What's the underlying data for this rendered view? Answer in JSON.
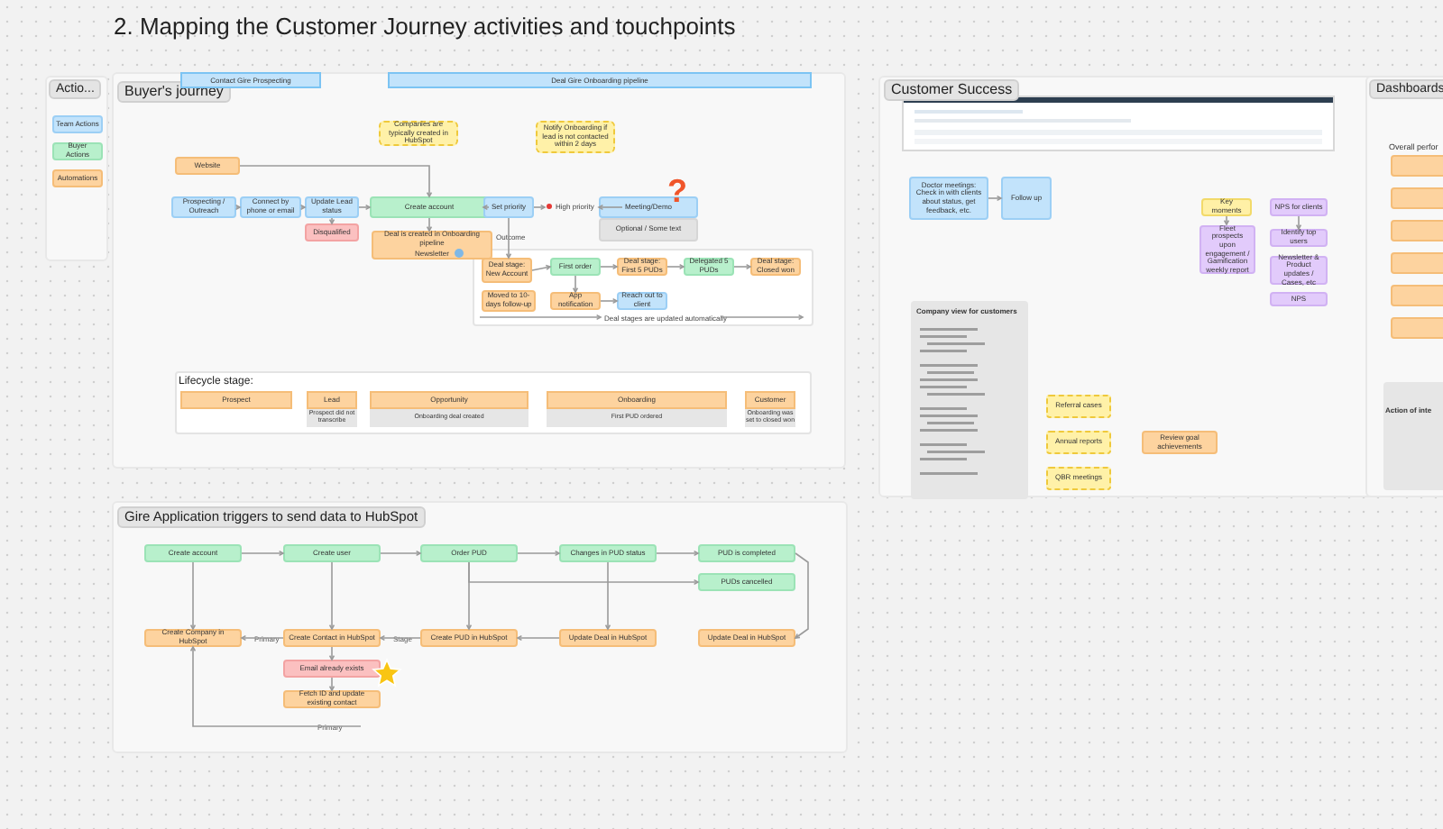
{
  "page_title": "2. Mapping the Customer Journey activities and touchpoints",
  "legend": {
    "title": "Actio...",
    "items": [
      {
        "label": "Team Actions",
        "kind": "blue"
      },
      {
        "label": "Buyer Actions",
        "kind": "green"
      },
      {
        "label": "Automations",
        "kind": "orange"
      }
    ]
  },
  "buyer_journey": {
    "title": "Buyer's journey",
    "banners": [
      "Contact Gire Prospecting",
      "Deal Gire Onboarding pipeline"
    ],
    "notes": [
      "Companies are typically created in HubSpot",
      "Notify Onboarding if lead is not contacted within 2 days"
    ],
    "nodes": [
      {
        "text": "Website",
        "kind": "orange"
      },
      {
        "text": "Prospecting / Outreach",
        "kind": "blue"
      },
      {
        "text": "Connect by phone or email",
        "kind": "blue"
      },
      {
        "text": "Update Lead status",
        "kind": "blue"
      },
      {
        "text": "Disqualified",
        "kind": "red"
      },
      {
        "text": "Create account",
        "kind": "green"
      },
      {
        "text": "Deal is created in Onboarding pipeline",
        "kind": "orange",
        "sub": "Newsletter"
      },
      {
        "text": "Set priority",
        "kind": "blue"
      },
      {
        "text": "Meeting/Demo",
        "kind": "blue"
      },
      {
        "text": "Optional / Some text",
        "kind": "gray"
      },
      {
        "text": "Deal stage: New Account",
        "kind": "orange"
      },
      {
        "text": "First order",
        "kind": "green"
      },
      {
        "text": "Deal stage: First 5 PUDs",
        "kind": "orange"
      },
      {
        "text": "Delegated 5 PUDs",
        "kind": "green"
      },
      {
        "text": "Deal stage: Closed won",
        "kind": "orange"
      },
      {
        "text": "Moved to 10-days follow-up",
        "kind": "orange"
      },
      {
        "text": "App notification",
        "kind": "orange"
      },
      {
        "text": "Reach out to client",
        "kind": "blue"
      }
    ],
    "question_mark": "?",
    "priority_label": "High priority",
    "outcome_label": "Outcome",
    "auto_label": "Deal stages are updated automatically",
    "lifecycle": {
      "title": "Lifecycle stage:",
      "stages": [
        {
          "name": "Prospect"
        },
        {
          "name": "Lead",
          "note": "Prospect did not transcribe"
        },
        {
          "name": "Opportunity",
          "note": "Onboarding deal created"
        },
        {
          "name": "Onboarding",
          "note": "First PUD ordered"
        },
        {
          "name": "Customer",
          "note": "Onboarding was set to closed won"
        }
      ]
    }
  },
  "triggers": {
    "title": "Gire Application triggers to send data to HubSpot",
    "nodes": [
      {
        "text": "Create account",
        "kind": "green"
      },
      {
        "text": "Create user",
        "kind": "green"
      },
      {
        "text": "Order PUD",
        "kind": "green"
      },
      {
        "text": "Changes in PUD status",
        "kind": "green"
      },
      {
        "text": "PUD is completed",
        "kind": "green"
      },
      {
        "text": "PUDs cancelled",
        "kind": "green"
      },
      {
        "text": "Create Company in HubSpot",
        "kind": "orange"
      },
      {
        "text": "Create Contact in HubSpot",
        "kind": "orange"
      },
      {
        "text": "Create PUD in HubSpot",
        "kind": "orange"
      },
      {
        "text": "Update Deal in HubSpot",
        "kind": "orange"
      },
      {
        "text": "Update Deal in HubSpot",
        "kind": "orange"
      },
      {
        "text": "Email already exists",
        "kind": "red"
      },
      {
        "text": "Fetch ID and update existing contact",
        "kind": "orange"
      }
    ],
    "edge_labels": [
      "Primary",
      "Stage",
      "Primary"
    ]
  },
  "customer_success": {
    "title": "Customer Success",
    "nodes": [
      {
        "text": "Doctor meetings: Check in with clients about status, get feedback, etc.",
        "kind": "blue"
      },
      {
        "text": "Follow up",
        "kind": "blue"
      },
      {
        "text": "Key moments",
        "kind": "yellow"
      },
      {
        "text": "Fleet prospects upon engagement / Gamification weekly report",
        "kind": "purple"
      },
      {
        "text": "NPS for clients",
        "kind": "purple"
      },
      {
        "text": "Identify top users",
        "kind": "purple"
      },
      {
        "text": "Newsletter & Product updates / Cases, etc",
        "kind": "purple"
      },
      {
        "text": "NPS",
        "kind": "purple"
      },
      {
        "text": "Referral cases",
        "kind": "sticky"
      },
      {
        "text": "Annual reports",
        "kind": "sticky"
      },
      {
        "text": "QBR meetings",
        "kind": "sticky"
      },
      {
        "text": "Review goal achievements",
        "kind": "orange"
      }
    ],
    "company_view": {
      "title": "Company view for customers"
    }
  },
  "dashboards": {
    "title": "Dashboards",
    "subtitle": "Overall perfor",
    "panel_title": "Action of inte"
  }
}
